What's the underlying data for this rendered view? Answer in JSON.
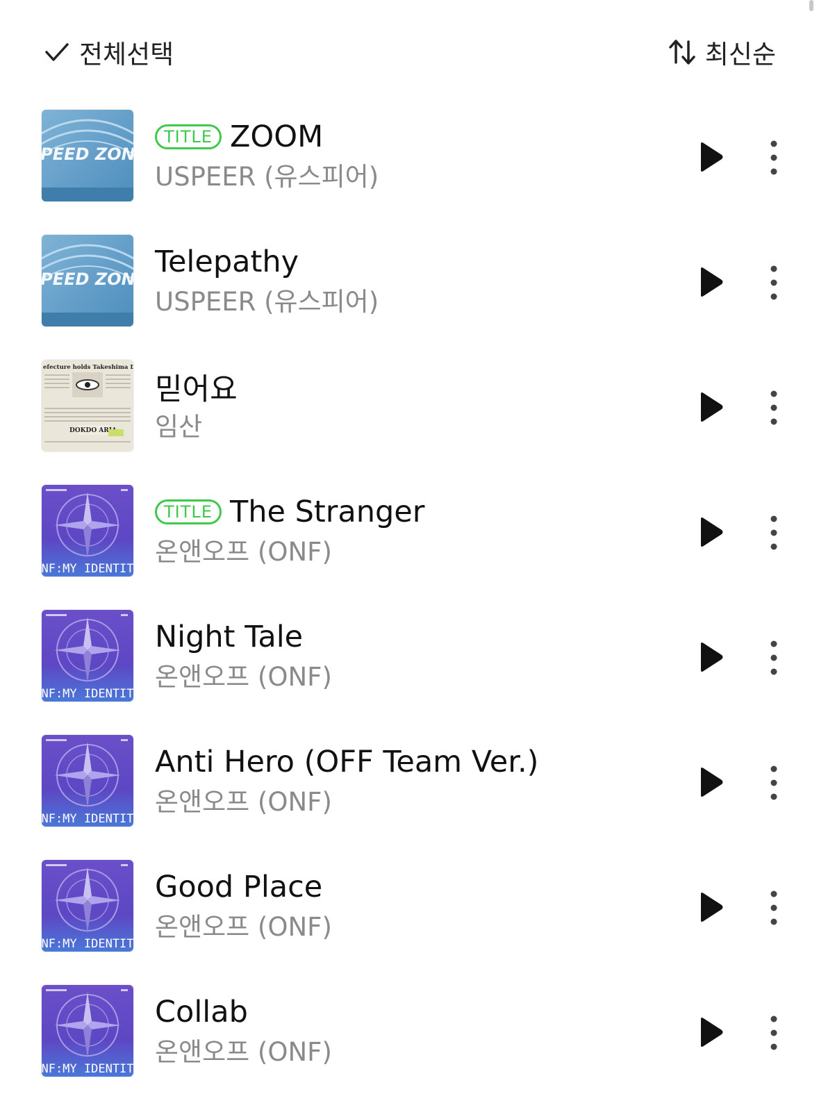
{
  "toolbar": {
    "select_all_label": "전체선택",
    "select_icon": "checkmark-icon",
    "sort_label": "최신순",
    "sort_icon": "sort-arrows-icon"
  },
  "tracks": [
    {
      "title": "ZOOM",
      "artist": "USPEER (유스피어)",
      "is_title": true,
      "badge": "TITLE",
      "cover": "speed-zone-cover"
    },
    {
      "title": "Telepathy",
      "artist": "USPEER (유스피어)",
      "is_title": false,
      "badge": "",
      "cover": "speed-zone-cover"
    },
    {
      "title": "믿어요",
      "artist": "임산",
      "is_title": false,
      "badge": "",
      "cover": "dokdo-aria-cover"
    },
    {
      "title": "The Stranger",
      "artist": "온앤오프 (ONF)",
      "is_title": true,
      "badge": "TITLE",
      "cover": "onf-my-identity-cover"
    },
    {
      "title": "Night Tale",
      "artist": "온앤오프 (ONF)",
      "is_title": false,
      "badge": "",
      "cover": "onf-my-identity-cover"
    },
    {
      "title": "Anti Hero (OFF Team Ver.)",
      "artist": "온앤오프 (ONF)",
      "is_title": false,
      "badge": "",
      "cover": "onf-my-identity-cover"
    },
    {
      "title": "Good Place",
      "artist": "온앤오프 (ONF)",
      "is_title": false,
      "badge": "",
      "cover": "onf-my-identity-cover"
    },
    {
      "title": "Collab",
      "artist": "온앤오프 (ONF)",
      "is_title": false,
      "badge": "",
      "cover": "onf-my-identity-cover"
    }
  ],
  "cover_texts": {
    "speed_zone": "SPEED ZONE",
    "dokdo_headline": "efecture holds Takeshima Da",
    "dokdo_label": "DOKDO ARIA",
    "onf": "ONF:MY IDENTITY"
  },
  "colors": {
    "badge_green": "#3ec94a",
    "artist_gray": "#8a8a8a",
    "title_black": "#111111"
  }
}
